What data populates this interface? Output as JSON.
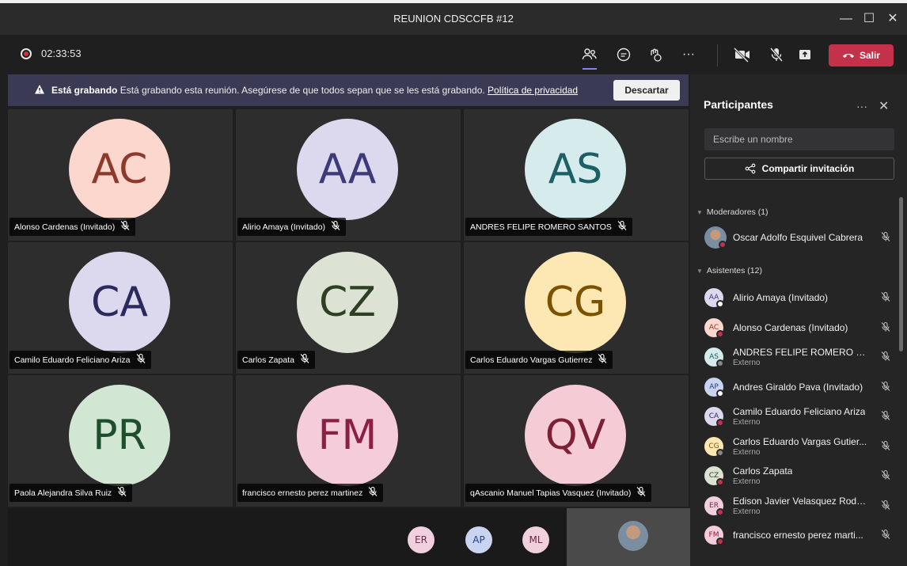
{
  "window": {
    "title": "REUNION CDSCCFB #12"
  },
  "meeting": {
    "timer": "02:33:53",
    "leave_label": "Salir"
  },
  "banner": {
    "bold_text": "Está grabando",
    "message": " Está grabando esta reunión. Asegúrese de que todos sepan que se les está grabando. ",
    "link": "Política de privacidad",
    "dismiss_label": "Descartar"
  },
  "grid": [
    {
      "initials": "AC",
      "name": "Alonso Cardenas (Invitado)",
      "bg": "#fbd7cd",
      "fg": "#8c3a2b"
    },
    {
      "initials": "AA",
      "name": "Alirio Amaya (Invitado)",
      "bg": "#dcd9ee",
      "fg": "#3d3a7a"
    },
    {
      "initials": "AS",
      "name": "ANDRES FELIPE ROMERO SANTOS",
      "bg": "#d6ecec",
      "fg": "#1d5f66"
    },
    {
      "initials": "CA",
      "name": "Camilo Eduardo Feliciano Ariza",
      "bg": "#dcd9ee",
      "fg": "#2b2a5c"
    },
    {
      "initials": "CZ",
      "name": "Carlos Zapata",
      "bg": "#dce3d5",
      "fg": "#2f3f24"
    },
    {
      "initials": "CG",
      "name": "Carlos Eduardo Vargas Gutierrez",
      "bg": "#fde8b4",
      "fg": "#7a5200"
    },
    {
      "initials": "PR",
      "name": "Paola Alejandra Silva Ruiz",
      "bg": "#d2e6d4",
      "fg": "#1f4e2c"
    },
    {
      "initials": "FM",
      "name": "francisco ernesto perez martinez",
      "bg": "#f5ccd9",
      "fg": "#8c1f44"
    },
    {
      "initials": "QV",
      "name": "qAscanio Manuel Tapias Vasquez (Invitado)",
      "bg": "#f5ccd6",
      "fg": "#7d1f35"
    }
  ],
  "strip": [
    {
      "initials": "ER",
      "bg": "#f0d0df",
      "fg": "#7a2a4f"
    },
    {
      "initials": "AP",
      "bg": "#c9d4f1",
      "fg": "#283f87"
    },
    {
      "initials": "ML",
      "bg": "#f0d0dc",
      "fg": "#6b2740"
    }
  ],
  "panel": {
    "title": "Participantes",
    "search_placeholder": "Escribe un nombre",
    "share_label": "Compartir invitación",
    "moderators_label": "Moderadores (1)",
    "attendees_label": "Asistentes (12)",
    "moderator": {
      "name": "Oscar Adolfo Esquivel Cabrera"
    },
    "attendees": [
      {
        "initials": "AA",
        "name": "Alirio Amaya (Invitado)",
        "sub": "",
        "bg": "#dcd9ee",
        "fg": "#3d3a7a",
        "status": "#fff"
      },
      {
        "initials": "AC",
        "name": "Alonso Cardenas (Invitado)",
        "sub": "",
        "bg": "#fbd7cd",
        "fg": "#8c3a2b",
        "status": "#c4314b"
      },
      {
        "initials": "AS",
        "name": "ANDRES FELIPE ROMERO SA...",
        "sub": "Externo",
        "bg": "#d6ecec",
        "fg": "#1d5f66",
        "status": "#8a8886"
      },
      {
        "initials": "AP",
        "name": "Andres Giraldo Pava (Invitado)",
        "sub": "",
        "bg": "#c9d4f1",
        "fg": "#283f87",
        "status": "#fff"
      },
      {
        "initials": "CA",
        "name": "Camilo Eduardo Feliciano Ariza",
        "sub": "Externo",
        "bg": "#dcd9ee",
        "fg": "#2b2a5c",
        "status": "#c4314b"
      },
      {
        "initials": "CG",
        "name": "Carlos Eduardo Vargas Gutier...",
        "sub": "Externo",
        "bg": "#fde8b4",
        "fg": "#7a5200",
        "status": "#8a8886"
      },
      {
        "initials": "CZ",
        "name": "Carlos Zapata",
        "sub": "Externo",
        "bg": "#dce3d5",
        "fg": "#2f3f24",
        "status": "#c4314b"
      },
      {
        "initials": "ER",
        "name": "Edison Javier Velasquez Rodri...",
        "sub": "Externo",
        "bg": "#f0d0df",
        "fg": "#7a2a4f",
        "status": "#c4314b"
      },
      {
        "initials": "FM",
        "name": "francisco ernesto perez marti...",
        "sub": "",
        "bg": "#f5ccd9",
        "fg": "#8c1f44",
        "status": "#c4314b"
      }
    ]
  }
}
